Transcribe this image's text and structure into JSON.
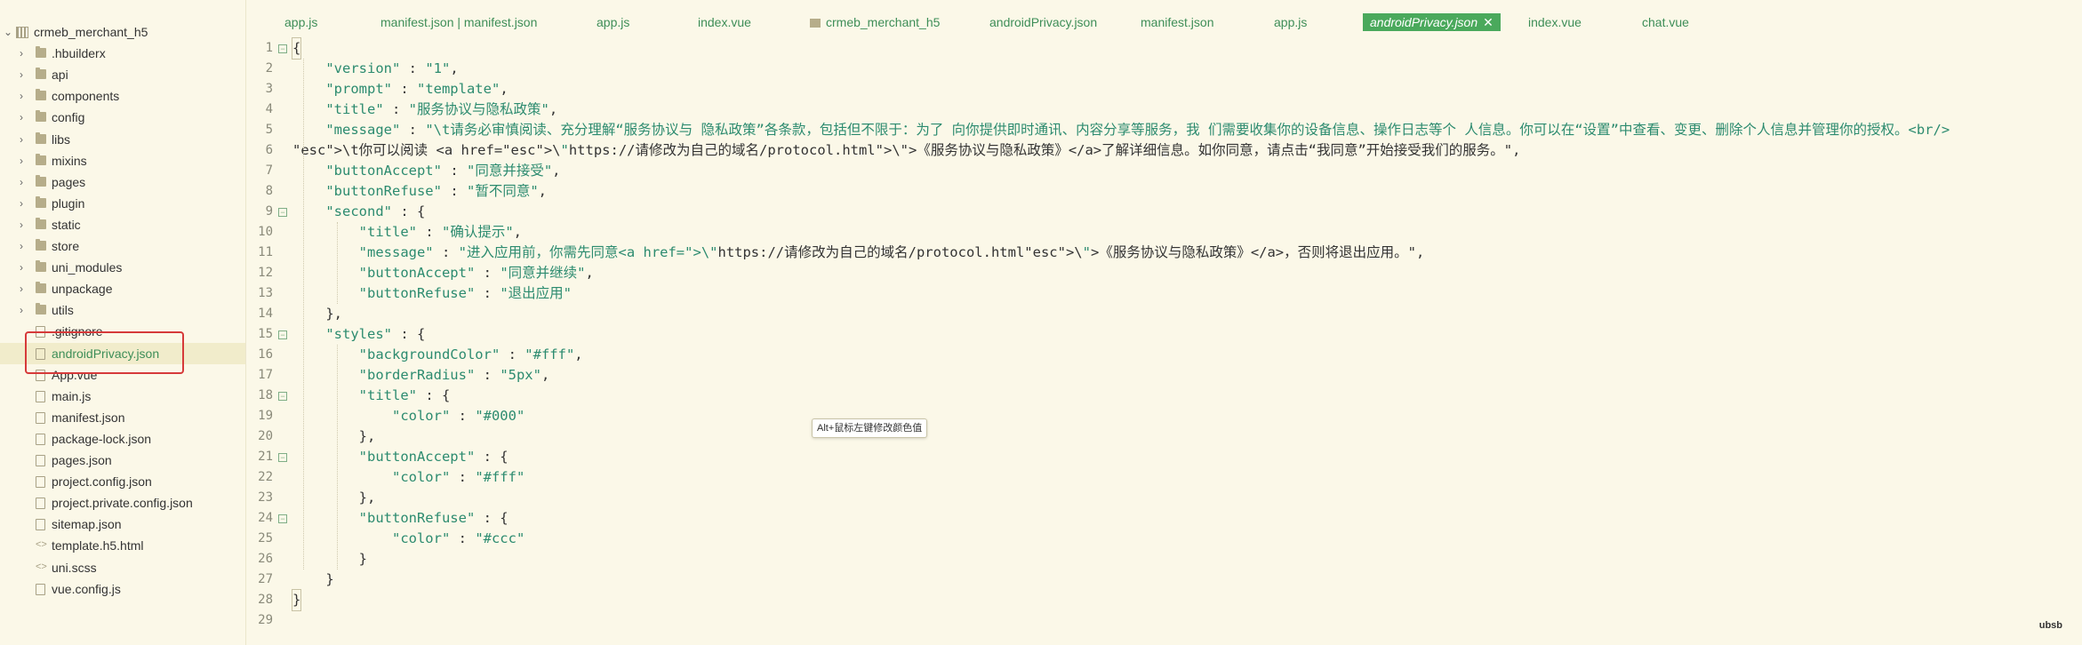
{
  "explorer": {
    "root": "crmeb_merchant_h5",
    "items": [
      {
        "label": ".hbuilderx",
        "type": "folder"
      },
      {
        "label": "api",
        "type": "folder"
      },
      {
        "label": "components",
        "type": "folder"
      },
      {
        "label": "config",
        "type": "folder"
      },
      {
        "label": "libs",
        "type": "folder"
      },
      {
        "label": "mixins",
        "type": "folder"
      },
      {
        "label": "pages",
        "type": "folder"
      },
      {
        "label": "plugin",
        "type": "folder"
      },
      {
        "label": "static",
        "type": "folder"
      },
      {
        "label": "store",
        "type": "folder"
      },
      {
        "label": "uni_modules",
        "type": "folder"
      },
      {
        "label": "unpackage",
        "type": "folder"
      },
      {
        "label": "utils",
        "type": "folder"
      },
      {
        "label": ".gitignore",
        "type": "file"
      },
      {
        "label": "androidPrivacy.json",
        "type": "json",
        "selected": true
      },
      {
        "label": "App.vue",
        "type": "file"
      },
      {
        "label": "main.js",
        "type": "file"
      },
      {
        "label": "manifest.json",
        "type": "json"
      },
      {
        "label": "package-lock.json",
        "type": "json"
      },
      {
        "label": "pages.json",
        "type": "json"
      },
      {
        "label": "project.config.json",
        "type": "json"
      },
      {
        "label": "project.private.config.json",
        "type": "json"
      },
      {
        "label": "sitemap.json",
        "type": "json"
      },
      {
        "label": "template.h5.html",
        "type": "code"
      },
      {
        "label": "uni.scss",
        "type": "code"
      },
      {
        "label": "vue.config.js",
        "type": "file"
      }
    ]
  },
  "tabs": [
    {
      "label": "app.js"
    },
    {
      "label": "manifest.json | manifest.json"
    },
    {
      "label": "app.js"
    },
    {
      "label": "index.vue"
    },
    {
      "label": "crmeb_merchant_h5",
      "folder": true
    },
    {
      "label": "androidPrivacy.json"
    },
    {
      "label": "manifest.json"
    },
    {
      "label": "app.js"
    },
    {
      "label": "androidPrivacy.json",
      "active": true,
      "close": "✕"
    },
    {
      "label": "index.vue"
    },
    {
      "label": "chat.vue"
    }
  ],
  "code": {
    "lines": [
      "{",
      "    \"version\" : \"1\",",
      "    \"prompt\" : \"template\",",
      "    \"title\" : \"服务协议与隐私政策\",",
      "    \"message\" : \"\\t请务必审慎阅读、充分理解“服务协议与 隐私政策”各条款，包括但不限于：为了 向你提供即时通讯、内容分享等服务，我 们需要收集你的设备信息、操作日志等个 人信息。你可以在“设置”中查看、变更、删除个人信息并管理你的授权。<br/>",
      "\\t你可以阅读 <a href=\\\"https://请修改为自己的域名/protocol.html\\\">《服务协议与隐私政策》</a>了解详细信息。如你同意，请点击“我同意”开始接受我们的服务。\",",
      "    \"buttonAccept\" : \"同意并接受\",",
      "    \"buttonRefuse\" : \"暂不同意\",",
      "    \"second\" : {",
      "        \"title\" : \"确认提示\",",
      "        \"message\" : \"进入应用前，你需先同意<a href=\\\"https://请修改为自己的域名/protocol.html\\\">《服务协议与隐私政策》</a>，否则将退出应用。\",",
      "        \"buttonAccept\" : \"同意并继续\",",
      "        \"buttonRefuse\" : \"退出应用\"",
      "    },",
      "    \"styles\" : {",
      "        \"backgroundColor\" : \"#fff\",",
      "        \"borderRadius\" : \"5px\",",
      "        \"title\" : {",
      "            \"color\" : \"#000\"",
      "        },",
      "        \"buttonAccept\" : {",
      "            \"color\" : \"#fff\"",
      "        },",
      "        \"buttonRefuse\" : {",
      "            \"color\" : \"#ccc\"",
      "        }",
      "    }",
      "}",
      ""
    ],
    "fold_lines": [
      1,
      9,
      15,
      18,
      21,
      24
    ]
  },
  "tooltip": "Alt+鼠标左键修改颜色值",
  "watermark": "ubsb",
  "colors": {
    "accent": "#4aa95c",
    "highlight_box": "#d63a3a",
    "background": "#fbf8e8"
  }
}
